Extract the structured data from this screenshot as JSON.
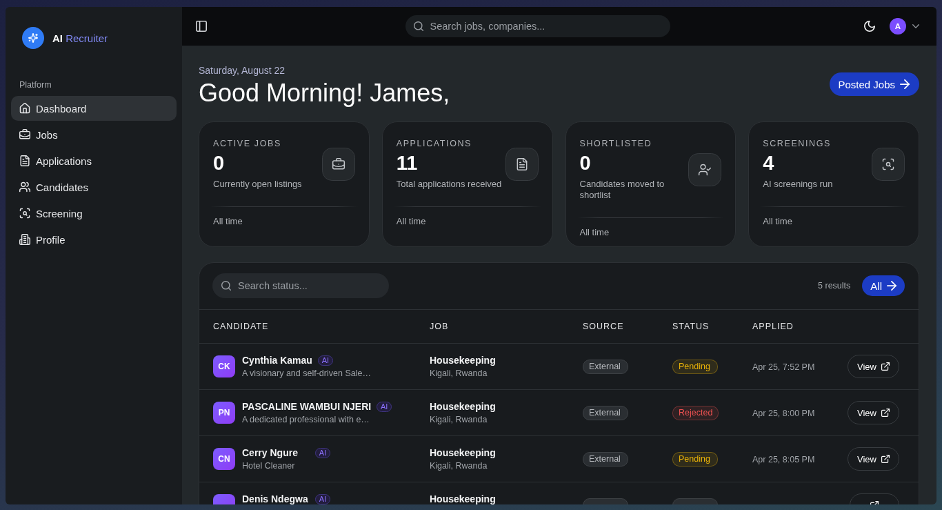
{
  "sidebar": {
    "brand": {
      "prefix": "AI",
      "name": "Recruiter"
    },
    "section_label": "Platform",
    "items": [
      {
        "label": "Dashboard",
        "selected": true
      },
      {
        "label": "Jobs",
        "selected": false
      },
      {
        "label": "Applications",
        "selected": false
      },
      {
        "label": "Candidates",
        "selected": false
      },
      {
        "label": "Screening",
        "selected": false
      },
      {
        "label": "Profile",
        "selected": false
      }
    ]
  },
  "top_bar": {
    "search": {
      "placeholder": "Search jobs, companies..."
    },
    "avatar": "A"
  },
  "header": {
    "date": "Saturday, August 22",
    "greeting": "Good Morning! James,",
    "button": "Posted Jobs"
  },
  "stats": [
    {
      "label": "ACTIVE JOBS",
      "value": "0",
      "caption": "Currently open listings",
      "period": "All time"
    },
    {
      "label": "APPLICATIONS",
      "value": "11",
      "caption": "Total applications received",
      "period": "All time"
    },
    {
      "label": "SHORTLISTED",
      "value": "0",
      "caption": "Candidates moved to shortlist",
      "period": "All time"
    },
    {
      "label": "SCREENINGS",
      "value": "4",
      "caption": "AI screenings run",
      "period": "All time"
    }
  ],
  "table": {
    "search": {
      "placeholder": "Search status..."
    },
    "result_count": "5 results",
    "filter_button": "All",
    "columns": [
      "CANDIDATE",
      "JOB",
      "SOURCE",
      "STATUS",
      "APPLIED"
    ],
    "rows": [
      {
        "initials": "CK",
        "name": "Cynthia Kamau",
        "badge": "AI",
        "summary": "A visionary and self-driven Sale…",
        "job": "Housekeeping",
        "location": "Kigali, Rwanda",
        "source": "External",
        "status": {
          "label": "Pending",
          "color": "#eab308"
        },
        "applied": "Apr 25, 7:52 PM",
        "action": "View"
      },
      {
        "initials": "PN",
        "name": "PASCALINE WAMBUI NJERI",
        "badge": "AI",
        "summary": "A dedicated professional with e…",
        "job": "Housekeeping",
        "location": "Kigali, Rwanda",
        "source": "External",
        "status": {
          "label": "Rejected",
          "color": "#f05252"
        },
        "applied": "Apr 25, 8:00 PM",
        "action": "View"
      },
      {
        "initials": "CN",
        "name": "Cerry Ngure",
        "badge": "AI",
        "summary": "Hotel Cleaner",
        "job": "Housekeeping",
        "location": "Kigali, Rwanda",
        "source": "External",
        "status": {
          "label": "Pending",
          "color": "#eab308"
        },
        "applied": "Apr 25, 8:05 PM",
        "action": "View"
      },
      {
        "name": "Denis Ndegwa",
        "badge": "AI",
        "job": "Housekeeping"
      }
    ]
  }
}
